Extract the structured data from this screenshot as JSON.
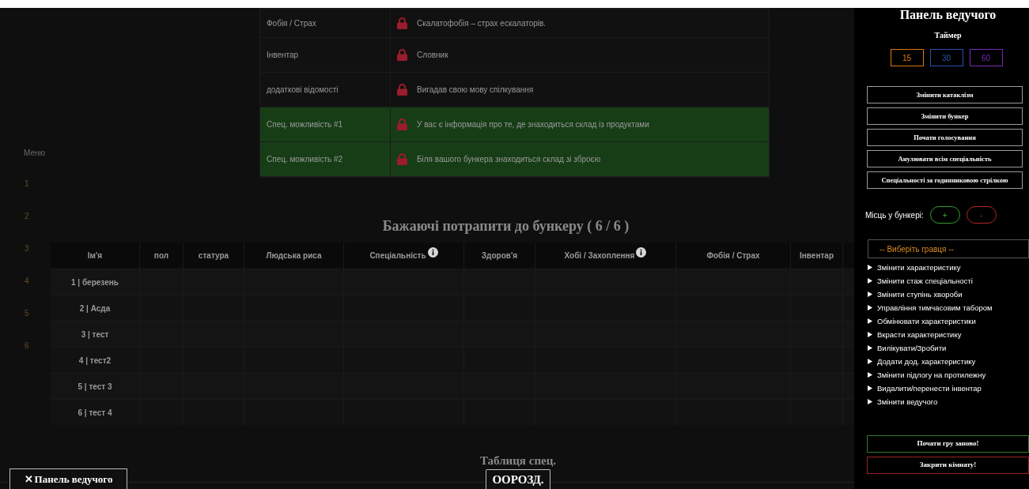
{
  "menu": {
    "label": "Меню",
    "items": [
      "1",
      "2",
      "3",
      "4",
      "5",
      "6"
    ]
  },
  "details": [
    {
      "label": "Фобія / Страх",
      "value": "Скалатофобія – страх ескалаторів.",
      "highlighted": false
    },
    {
      "label": "Інвентар",
      "value": "Словник",
      "highlighted": false
    },
    {
      "label": "додаткові відомості",
      "value": "Вигадав свою мову спілкування",
      "highlighted": false
    },
    {
      "label": "Спец. можливість #1",
      "value": "У вас є інформація про те, де знаходиться склад із продуктами",
      "highlighted": true
    },
    {
      "label": "Спец. можливість #2",
      "value": "Біля вашого бункера знаходиться склад зі зброєю",
      "highlighted": true
    }
  ],
  "players": {
    "title": "Бажаючі потрапити до бункеру ( 6 / 6 )",
    "columns": [
      {
        "label": "Ім'я",
        "info": false
      },
      {
        "label": "пол",
        "info": false
      },
      {
        "label": "статура",
        "info": false
      },
      {
        "label": "Людська риса",
        "info": false
      },
      {
        "label": "Спеціальність",
        "info": true
      },
      {
        "label": "Здоров'я",
        "info": false
      },
      {
        "label": "Хобі / Захоплення",
        "info": true
      },
      {
        "label": "Фобія / Страх",
        "info": false
      },
      {
        "label": "Інвентар",
        "info": false
      }
    ],
    "rows": [
      "1 | березень",
      "2 | Асда",
      "3 | тест",
      "4 | тест2",
      "5 | тест 3",
      "6 | тест 4"
    ]
  },
  "spec_table": {
    "title": "Таблиця спец.",
    "button": "OOРОЗД."
  },
  "host_toggle": {
    "icon": "✕",
    "label": "Панель ведучого"
  },
  "host_panel": {
    "title": "Панель ведучого",
    "timer_label": "Таймер",
    "timers": [
      {
        "label": "15",
        "color": "#d97a12"
      },
      {
        "label": "30",
        "color": "#2a4fb0"
      },
      {
        "label": "60",
        "color": "#7a2ab8"
      }
    ],
    "actions": [
      "Змінити катаклізм",
      "Змінити бункер",
      "Почати голосування",
      "Анулювати всім спеціальність",
      "Спеціальності за годинниковою стрілкою"
    ],
    "seats": {
      "label": "Місць у бункері:",
      "buttons": [
        {
          "label": "+",
          "color": "#2f9e2f"
        },
        {
          "label": "-",
          "color": "#b02525"
        }
      ]
    },
    "player_select": {
      "placeholder": "-- Виберіть гравця --"
    },
    "sections": [
      "Змінити характеристику",
      "Змінити стаж спеціальності",
      "Змінити ступінь хвороби",
      "Управління тимчасовим табором",
      "Обмінювати характеристики",
      "Вкрасти характеристику",
      "Вилікувати/Зробити",
      "Додати дод. характеристику",
      "Змінити підлогу на протилежну",
      "Видалити/перенести інвентар",
      "Змінити ведучого"
    ],
    "footer_buttons": [
      {
        "label": "Почати гру заново!",
        "color": "#2c7a2c"
      },
      {
        "label": "Закрити кімнату!",
        "color": "#9a2222"
      }
    ]
  }
}
